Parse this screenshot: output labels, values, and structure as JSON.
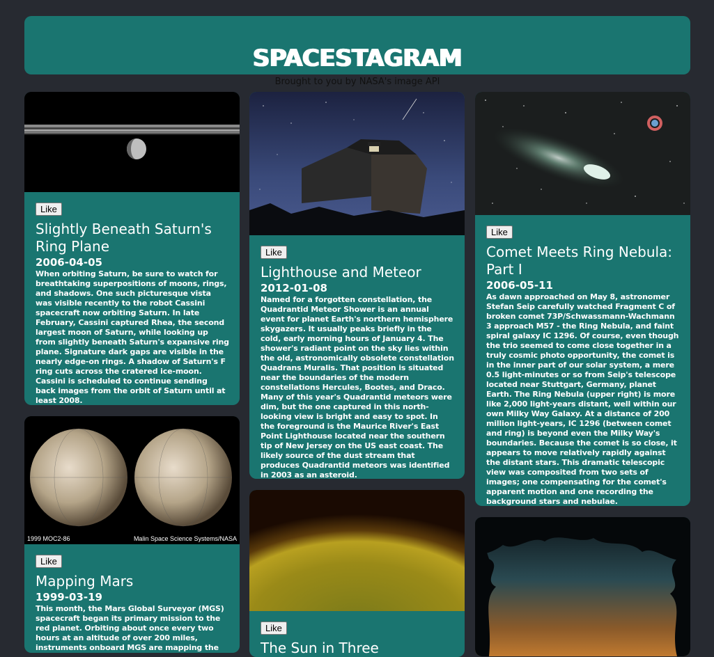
{
  "header": {
    "title": "SPACESTAGRAM",
    "subtitle": "Brought to you by NASA's image API"
  },
  "cards": [
    {
      "like_label": "Like",
      "title": "Slightly Beneath Saturn's Ring Plane",
      "date": "2006-04-05",
      "description": "When orbiting Saturn, be sure to watch for breathtaking superpositions of moons, rings, and shadows. One such picturesque vista was visible recently to the robot Cassini spacecraft now orbiting Saturn. In late February, Cassini captured Rhea, the second largest moon of Saturn, while looking up from slightly beneath Saturn's expansive ring plane. Signature dark gaps are visible in the nearly edge-on rings. A shadow of Saturn's F ring cuts across the cratered ice-moon. Cassini is scheduled to continue sending back images from the orbit of Saturn until at least 2008."
    },
    {
      "like_label": "Like",
      "title": "Lighthouse and Meteor",
      "date": "2012-01-08",
      "description": "Named for a forgotten constellation, the Quadrantid Meteor Shower is an annual event for planet Earth's northern hemisphere skygazers. It usually peaks briefly in the cold, early morning hours of January 4. The shower's radiant point on the sky lies within the old, astronomically obsolete constellation Quadrans Muralis. That position is situated near the boundaries of the modern constellations Hercules, Bootes, and Draco. Many of this year's Quadrantid meteors were dim, but the one captured in this north-looking view is bright and easy to spot. In the foreground is the Maurice River's East Point Lighthouse located near the southern tip of New Jersey on the US east coast. The likely source of the dust stream that produces Quadrantid meteors was identified in 2003 as an asteroid."
    },
    {
      "like_label": "Like",
      "title": "Comet Meets Ring Nebula: Part I",
      "date": "2006-05-11",
      "description": "As dawn approached on May 8, astronomer Stefan Seip carefully watched Fragment C of broken comet 73P/Schwassmann-Wachmann 3 approach M57 - the Ring Nebula, and faint spiral galaxy IC 1296. Of course, even though the trio seemed to come close together in a truly cosmic photo opportunity, the comet is in the inner part of our solar system, a mere 0.5 light-minutes or so from Seip's telescope located near Stuttgart, Germany, planet Earth. The Ring Nebula (upper right) is more like 2,000 light-years distant, well within our own Milky Way Galaxy. At a distance of 200 million light-years, IC 1296 (between comet and ring) is beyond even the Milky Way's boundaries. Because the comet is so close, it appears to move relatively rapidly against the distant stars. This dramatic telescopic view was composited from two sets of images; one compensating for the comet's apparent motion and one recording the background stars and nebulae."
    },
    {
      "like_label": "Like",
      "title": "Mapping Mars",
      "date": "1999-03-19",
      "description": "This month, the Mars Global Surveyor (MGS) spacecraft began its primary mission to the red planet. Orbiting about once every two hours at an altitude of over 200 miles, instruments onboard MGS are mapping the Martian",
      "image_caption_left": "1999 MOC2-86",
      "image_caption_right": "Malin Space Science Systems/NASA"
    },
    {
      "like_label": "Like",
      "title": "The Sun in Three"
    }
  ]
}
